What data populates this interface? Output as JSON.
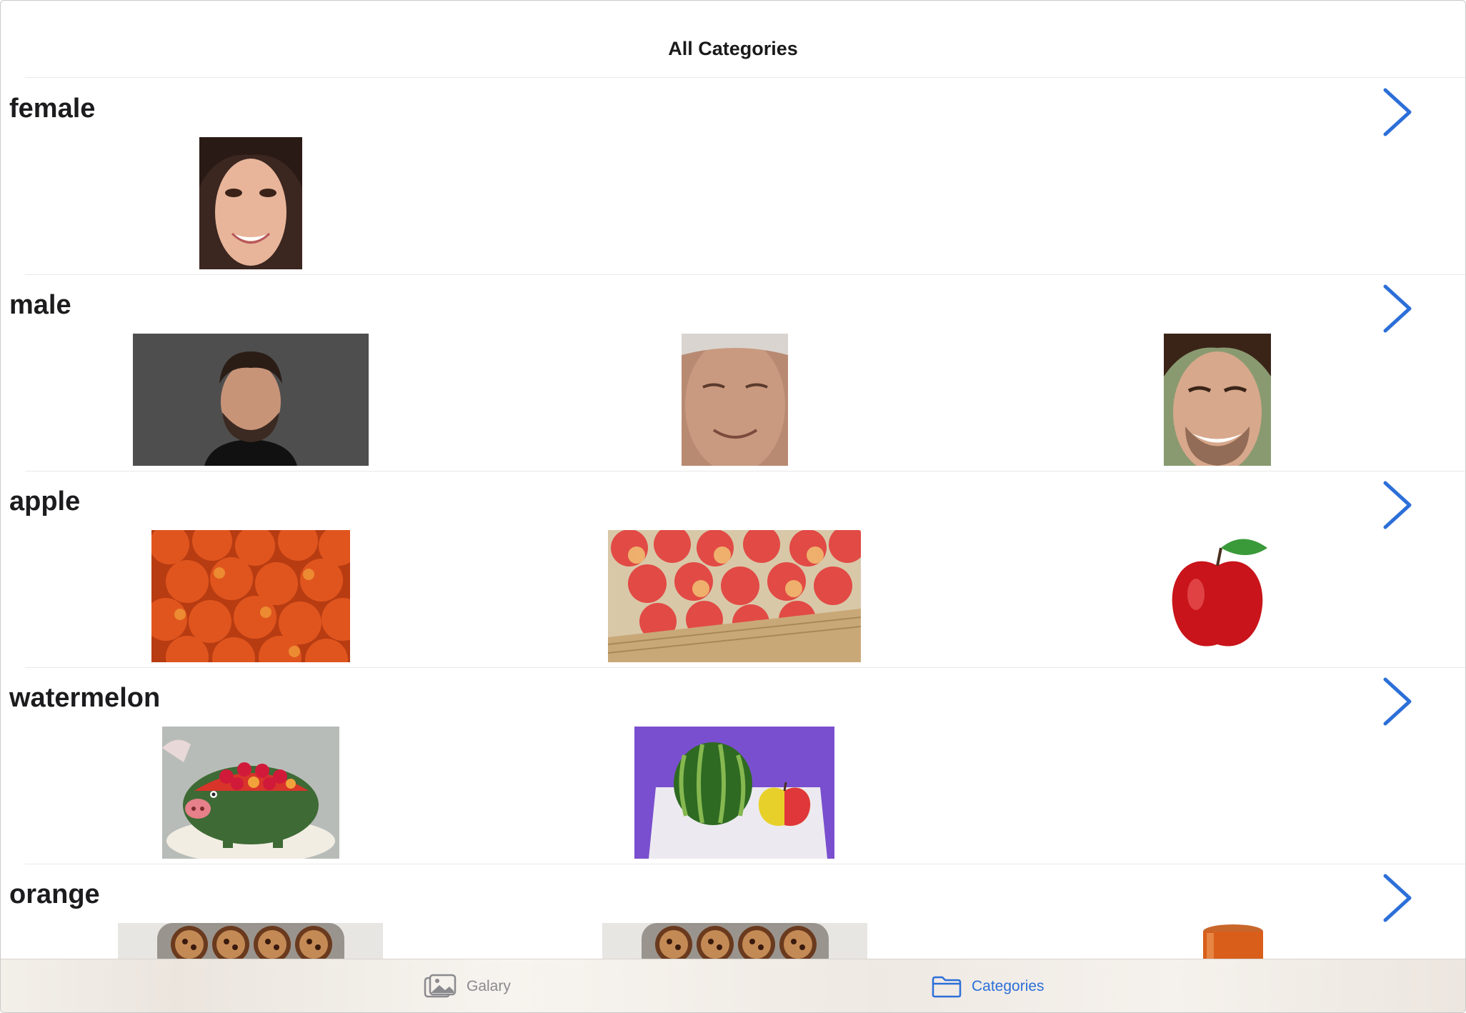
{
  "nav": {
    "title": "All Categories"
  },
  "sections": [
    {
      "title": "female"
    },
    {
      "title": "male"
    },
    {
      "title": "apple"
    },
    {
      "title": "watermelon"
    },
    {
      "title": "orange"
    }
  ],
  "tabs": [
    {
      "label": "Galary",
      "icon": "photos-icon",
      "selected": false
    },
    {
      "label": "Categories",
      "icon": "folder-icon",
      "selected": true
    }
  ],
  "colors": {
    "accent": "#2c6fd8",
    "inactive": "#8a8a8e",
    "title": "#1c1c1e",
    "separator": "#e8e8e8"
  }
}
